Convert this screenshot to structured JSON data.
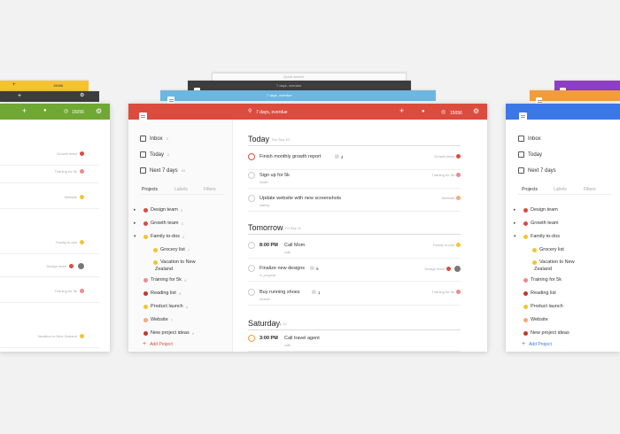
{
  "colors": {
    "red": "#db4c3f",
    "yellow": "#f4c430",
    "dark": "#3d3d3d",
    "blue": "#6db6e0",
    "green": "#6fa832",
    "orange": "#f39c3a",
    "purple": "#8e3ec4",
    "brightblue": "#3b78e7"
  },
  "main": {
    "search_placeholder": "7 days, overdue",
    "karma": "15056",
    "nav": [
      {
        "label": "Inbox",
        "count": "2"
      },
      {
        "label": "Today",
        "count": "2"
      },
      {
        "label": "Next 7 days",
        "count": "24"
      }
    ],
    "tabs": [
      "Projects",
      "Labels",
      "Filters"
    ],
    "projects": [
      {
        "label": "Design team",
        "count": "2",
        "color": "#db4c3f",
        "chevron": "▸"
      },
      {
        "label": "Growth team",
        "count": "3",
        "color": "#db4c3f",
        "chevron": "▸"
      },
      {
        "label": "Family to-dos",
        "count": "2",
        "color": "#f4c430",
        "chevron": "▾"
      },
      {
        "label": "Grocery list",
        "count": "7",
        "color": "#f4c430",
        "chevron": ""
      },
      {
        "label": "Vacation to New",
        "label2": "Zealand",
        "count": "",
        "color": "#f4c430",
        "chevron": ""
      },
      {
        "label": "Training for 5k",
        "count": "4",
        "color": "#ef8a8a",
        "chevron": ""
      },
      {
        "label": "Reading list",
        "count": "3",
        "color": "#c0392b",
        "chevron": ""
      },
      {
        "label": "Product launch",
        "count": "4",
        "color": "#f4c430",
        "chevron": ""
      },
      {
        "label": "Website",
        "count": "7",
        "color": "#f4a97a",
        "chevron": ""
      },
      {
        "label": "New project ideas",
        "count": "4",
        "color": "#c0392b",
        "chevron": ""
      }
    ],
    "add_project": "Add Project",
    "sections": [
      {
        "day": "Today",
        "date": "Thu Sep 10",
        "tasks": [
          {
            "label": "Finish monthly growth report",
            "sub": "",
            "comments": "4",
            "project": "Growth team",
            "pcolor": "#db4c3f",
            "time": "",
            "ring": "#db4c3f"
          },
          {
            "label": "Sign up for 5k",
            "sub": "health",
            "comments": "",
            "project": "Training for 5k",
            "pcolor": "#ef8a8a",
            "time": "",
            "ring": ""
          },
          {
            "label": "Update website with new screenshots",
            "sub": "waiting",
            "comments": "",
            "project": "Website",
            "pcolor": "#f4a97a",
            "time": "",
            "ring": ""
          }
        ]
      },
      {
        "day": "Tomorrow",
        "date": "Fri Sep 11",
        "tasks": [
          {
            "label": "Call Mom",
            "sub": "calls",
            "comments": "",
            "project": "Family to-dos",
            "pcolor": "#f4c430",
            "time": "8:00 PM",
            "ring": ""
          },
          {
            "label": "Finalize new designs",
            "sub": "in_progress",
            "comments": "5",
            "project": "Design team",
            "pcolor": "#db4c3f",
            "time": "",
            "ring": ""
          },
          {
            "label": "Buy running shoes",
            "sub": "errands",
            "comments": "1",
            "project": "Training for 5k",
            "pcolor": "#ef8a8a",
            "time": "",
            "ring": ""
          }
        ]
      },
      {
        "day": "Saturday",
        "date": "Sep 12",
        "tasks": [
          {
            "label": "Call travel agent",
            "sub": "calls",
            "comments": "",
            "project": "",
            "pcolor": "",
            "time": "3:00 PM",
            "ring": "#f39c3a"
          }
        ]
      }
    ]
  },
  "left": {
    "karma": "15056",
    "rows": [
      {
        "label": "Growth team",
        "color": "#db4c3f"
      },
      {
        "label": "Training for 5k",
        "color": "#ef8a8a"
      },
      {
        "label": "Website",
        "color": "#f4c430"
      },
      {
        "label": "Family to-dos",
        "color": "#f4c430"
      },
      {
        "label": "Design team",
        "color": "#db4c3f"
      },
      {
        "label": "Training for 5k",
        "color": "#ef8a8a"
      },
      {
        "label": "Vacation to New Zealand",
        "color": "#f4c430"
      }
    ]
  },
  "right": {
    "nav": [
      "Inbox",
      "Today",
      "Next 7 days"
    ],
    "tabs": [
      "Projects",
      "Labels",
      "Filters"
    ],
    "projects": [
      {
        "label": "Design team",
        "color": "#db4c3f",
        "chevron": "▸"
      },
      {
        "label": "Growth team",
        "color": "#db4c3f",
        "chevron": "▸"
      },
      {
        "label": "Family to-dos",
        "color": "#f4c430",
        "chevron": "▾"
      },
      {
        "label": "Grocery list",
        "color": "#f4c430",
        "chevron": ""
      },
      {
        "label": "Vacation to New",
        "label2": "Zealand",
        "color": "#f4c430",
        "chevron": ""
      },
      {
        "label": "Training for 5k",
        "color": "#ef8a8a",
        "chevron": ""
      },
      {
        "label": "Reading list",
        "color": "#c0392b",
        "chevron": ""
      },
      {
        "label": "Product launch",
        "color": "#f4c430",
        "chevron": ""
      },
      {
        "label": "Website",
        "color": "#f4a97a",
        "chevron": ""
      },
      {
        "label": "New project ideas",
        "color": "#c0392b",
        "chevron": ""
      }
    ],
    "add_project": "Add Project"
  },
  "back": {
    "dark_search": "7 days, overdue",
    "blue_search": "7 days, overdue",
    "top_search": "Quick search",
    "yellow_karma": "15056"
  }
}
